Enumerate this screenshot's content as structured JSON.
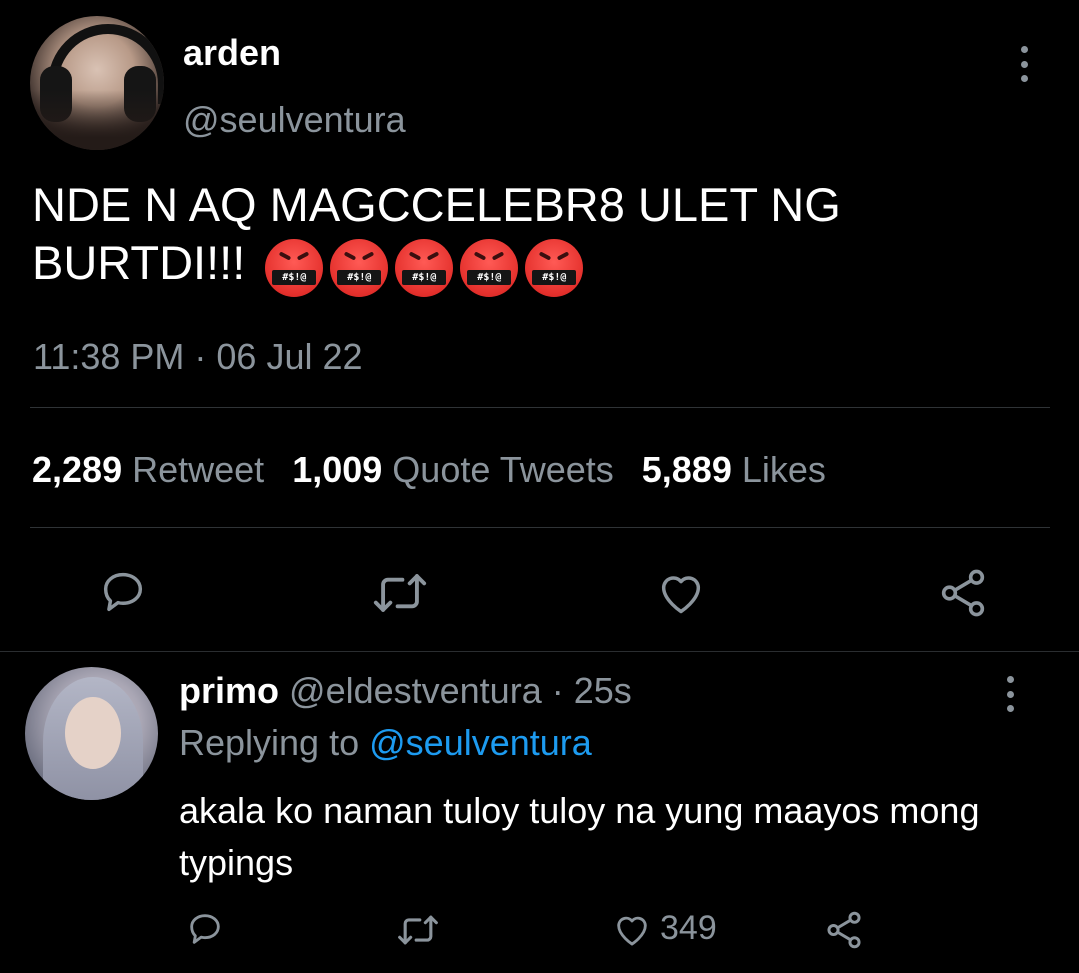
{
  "tweet": {
    "avatar_icon": "user-avatar-arden",
    "display_name": "arden",
    "handle": "@seulventura",
    "text": "NDE N AQ MAGCCELEBR8 ULET NG BURTDI!!!",
    "emoji_text": "#$!@",
    "emoji_count": 5,
    "timestamp": "11:38 PM · 06 Jul 22",
    "stats": {
      "retweets": "2,289",
      "retweets_label": "Retweet",
      "quotes": "1,009",
      "quotes_label": "Quote Tweets",
      "likes": "5,889",
      "likes_label": "Likes"
    },
    "actions": [
      "reply-icon",
      "retweet-icon",
      "like-icon",
      "share-icon"
    ]
  },
  "reply": {
    "avatar_icon": "user-avatar-primo",
    "display_name": "primo",
    "handle": "@eldestventura",
    "separator": "·",
    "time": "25s",
    "replying_prefix": "Replying to",
    "replying_to": "@seulventura",
    "text": "akala ko naman tuloy tuloy na yung maayos mong typings",
    "like_count": "349"
  },
  "colors": {
    "background": "#000000",
    "primary_text": "#ffffff",
    "secondary_text": "#8b949c",
    "link": "#1d9bf0",
    "divider": "#2f3336"
  }
}
